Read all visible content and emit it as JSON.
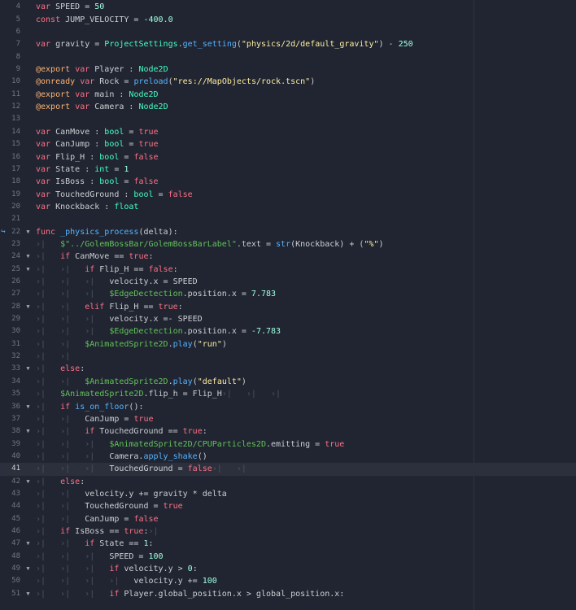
{
  "editor": {
    "current_line": 41,
    "executing_line": 22,
    "lines": [
      {
        "n": "4",
        "fold": false,
        "tokens": [
          [
            "k",
            "var"
          ],
          [
            "t",
            " SPEED = "
          ],
          [
            "n",
            "50"
          ]
        ]
      },
      {
        "n": "5",
        "fold": false,
        "tokens": [
          [
            "k",
            "const"
          ],
          [
            "t",
            " JUMP_VELOCITY = "
          ],
          [
            "n",
            "-400.0"
          ]
        ]
      },
      {
        "n": "6",
        "fold": false,
        "tokens": []
      },
      {
        "n": "7",
        "fold": false,
        "tokens": [
          [
            "k",
            "var"
          ],
          [
            "t",
            " gravity = "
          ],
          [
            "ty",
            "ProjectSettings"
          ],
          [
            "t",
            "."
          ],
          [
            "f",
            "get_setting"
          ],
          [
            "t",
            "("
          ],
          [
            "s",
            "\"physics/2d/default_gravity\""
          ],
          [
            "t",
            ") - "
          ],
          [
            "n",
            "250"
          ]
        ]
      },
      {
        "n": "8",
        "fold": false,
        "tokens": []
      },
      {
        "n": "9",
        "fold": false,
        "tokens": [
          [
            "an",
            "@export"
          ],
          [
            "t",
            " "
          ],
          [
            "k",
            "var"
          ],
          [
            "t",
            " Player : "
          ],
          [
            "ty",
            "Node2D"
          ]
        ]
      },
      {
        "n": "10",
        "fold": false,
        "tokens": [
          [
            "an",
            "@onready"
          ],
          [
            "t",
            " "
          ],
          [
            "k",
            "var"
          ],
          [
            "t",
            " Rock = "
          ],
          [
            "f",
            "preload"
          ],
          [
            "t",
            "("
          ],
          [
            "s",
            "\"res://MapObjects/rock.tscn\""
          ],
          [
            "t",
            ")"
          ]
        ]
      },
      {
        "n": "11",
        "fold": false,
        "tokens": [
          [
            "an",
            "@export"
          ],
          [
            "t",
            " "
          ],
          [
            "k",
            "var"
          ],
          [
            "t",
            " main : "
          ],
          [
            "ty",
            "Node2D"
          ]
        ]
      },
      {
        "n": "12",
        "fold": false,
        "tokens": [
          [
            "an",
            "@export"
          ],
          [
            "t",
            " "
          ],
          [
            "k",
            "var"
          ],
          [
            "t",
            " Camera : "
          ],
          [
            "ty",
            "Node2D"
          ]
        ]
      },
      {
        "n": "13",
        "fold": false,
        "tokens": []
      },
      {
        "n": "14",
        "fold": false,
        "tokens": [
          [
            "k",
            "var"
          ],
          [
            "t",
            " CanMove : "
          ],
          [
            "ty",
            "bool"
          ],
          [
            "t",
            " = "
          ],
          [
            "k",
            "true"
          ]
        ]
      },
      {
        "n": "15",
        "fold": false,
        "tokens": [
          [
            "k",
            "var"
          ],
          [
            "t",
            " CanJump : "
          ],
          [
            "ty",
            "bool"
          ],
          [
            "t",
            " = "
          ],
          [
            "k",
            "true"
          ]
        ]
      },
      {
        "n": "16",
        "fold": false,
        "tokens": [
          [
            "k",
            "var"
          ],
          [
            "t",
            " Flip_H : "
          ],
          [
            "ty",
            "bool"
          ],
          [
            "t",
            " = "
          ],
          [
            "k",
            "false"
          ]
        ]
      },
      {
        "n": "17",
        "fold": false,
        "tokens": [
          [
            "k",
            "var"
          ],
          [
            "t",
            " State : "
          ],
          [
            "ty",
            "int"
          ],
          [
            "t",
            " = "
          ],
          [
            "n",
            "1"
          ]
        ]
      },
      {
        "n": "18",
        "fold": false,
        "tokens": [
          [
            "k",
            "var"
          ],
          [
            "t",
            " IsBoss : "
          ],
          [
            "ty",
            "bool"
          ],
          [
            "t",
            " = "
          ],
          [
            "k",
            "false"
          ]
        ]
      },
      {
        "n": "19",
        "fold": false,
        "tokens": [
          [
            "k",
            "var"
          ],
          [
            "t",
            " TouchedGround : "
          ],
          [
            "ty",
            "bool"
          ],
          [
            "t",
            " = "
          ],
          [
            "k",
            "false"
          ]
        ]
      },
      {
        "n": "20",
        "fold": false,
        "tokens": [
          [
            "k",
            "var"
          ],
          [
            "t",
            " Knockback : "
          ],
          [
            "ty",
            "float"
          ]
        ]
      },
      {
        "n": "21",
        "fold": false,
        "tokens": []
      },
      {
        "n": "22",
        "fold": true,
        "tokens": [
          [
            "k",
            "func"
          ],
          [
            "t",
            " "
          ],
          [
            "f",
            "_physics_process"
          ],
          [
            "t",
            "(delta):"
          ]
        ]
      },
      {
        "n": "23",
        "fold": false,
        "tokens": [
          [
            "tab",
            "›|   "
          ],
          [
            "np",
            "$\"../GolemBossBar/GolemBossBarLabel\""
          ],
          [
            "t",
            ".text = "
          ],
          [
            "f",
            "str"
          ],
          [
            "t",
            "(Knockback) + ("
          ],
          [
            "s",
            "\"%\""
          ],
          [
            "t",
            ")"
          ]
        ]
      },
      {
        "n": "24",
        "fold": true,
        "tokens": [
          [
            "tab",
            "›|   "
          ],
          [
            "k",
            "if"
          ],
          [
            "t",
            " CanMove == "
          ],
          [
            "k",
            "true"
          ],
          [
            "t",
            ":"
          ]
        ]
      },
      {
        "n": "25",
        "fold": true,
        "tokens": [
          [
            "tab",
            "›|   ›|   "
          ],
          [
            "k",
            "if"
          ],
          [
            "t",
            " Flip_H == "
          ],
          [
            "k",
            "false"
          ],
          [
            "t",
            ":"
          ]
        ]
      },
      {
        "n": "26",
        "fold": false,
        "tokens": [
          [
            "tab",
            "›|   ›|   ›|   "
          ],
          [
            "t",
            "velocity.x = SPEED"
          ]
        ]
      },
      {
        "n": "27",
        "fold": false,
        "tokens": [
          [
            "tab",
            "›|   ›|   ›|   "
          ],
          [
            "np",
            "$EdgeDectection"
          ],
          [
            "t",
            ".position.x = "
          ],
          [
            "n",
            "7.783"
          ]
        ]
      },
      {
        "n": "28",
        "fold": true,
        "tokens": [
          [
            "tab",
            "›|   ›|   "
          ],
          [
            "k",
            "elif"
          ],
          [
            "t",
            " Flip_H == "
          ],
          [
            "k",
            "true"
          ],
          [
            "t",
            ":"
          ]
        ]
      },
      {
        "n": "29",
        "fold": false,
        "tokens": [
          [
            "tab",
            "›|   ›|   ›|   "
          ],
          [
            "t",
            "velocity.x =- SPEED"
          ]
        ]
      },
      {
        "n": "30",
        "fold": false,
        "tokens": [
          [
            "tab",
            "›|   ›|   ›|   "
          ],
          [
            "np",
            "$EdgeDectection"
          ],
          [
            "t",
            ".position.x = "
          ],
          [
            "n",
            "-7.783"
          ]
        ]
      },
      {
        "n": "31",
        "fold": false,
        "tokens": [
          [
            "tab",
            "›|   ›|   "
          ],
          [
            "np",
            "$AnimatedSprite2D"
          ],
          [
            "t",
            "."
          ],
          [
            "f",
            "play"
          ],
          [
            "t",
            "("
          ],
          [
            "s",
            "\"run\""
          ],
          [
            "t",
            ")"
          ]
        ]
      },
      {
        "n": "32",
        "fold": false,
        "tokens": [
          [
            "tab",
            "›|   ›|   "
          ]
        ]
      },
      {
        "n": "33",
        "fold": true,
        "tokens": [
          [
            "tab",
            "›|   "
          ],
          [
            "k",
            "else"
          ],
          [
            "t",
            ":"
          ]
        ]
      },
      {
        "n": "34",
        "fold": false,
        "tokens": [
          [
            "tab",
            "›|   ›|   "
          ],
          [
            "np",
            "$AnimatedSprite2D"
          ],
          [
            "t",
            "."
          ],
          [
            "f",
            "play"
          ],
          [
            "t",
            "("
          ],
          [
            "s",
            "\"default\""
          ],
          [
            "t",
            ")"
          ]
        ]
      },
      {
        "n": "35",
        "fold": false,
        "tokens": [
          [
            "tab",
            "›|   "
          ],
          [
            "np",
            "$AnimatedSprite2D"
          ],
          [
            "t",
            ".flip_h = Flip_H"
          ],
          [
            "tab",
            "›|   ›|   ›|"
          ]
        ]
      },
      {
        "n": "36",
        "fold": true,
        "tokens": [
          [
            "tab",
            "›|   "
          ],
          [
            "k",
            "if"
          ],
          [
            "t",
            " "
          ],
          [
            "f",
            "is_on_floor"
          ],
          [
            "t",
            "():"
          ]
        ]
      },
      {
        "n": "37",
        "fold": false,
        "tokens": [
          [
            "tab",
            "›|   ›|   "
          ],
          [
            "t",
            "CanJump = "
          ],
          [
            "k",
            "true"
          ]
        ]
      },
      {
        "n": "38",
        "fold": true,
        "tokens": [
          [
            "tab",
            "›|   ›|   "
          ],
          [
            "k",
            "if"
          ],
          [
            "t",
            " TouchedGround == "
          ],
          [
            "k",
            "true"
          ],
          [
            "t",
            ":"
          ]
        ]
      },
      {
        "n": "39",
        "fold": false,
        "tokens": [
          [
            "tab",
            "›|   ›|   ›|   "
          ],
          [
            "np",
            "$AnimatedSprite2D/CPUParticles2D"
          ],
          [
            "t",
            ".emitting = "
          ],
          [
            "k",
            "true"
          ]
        ]
      },
      {
        "n": "40",
        "fold": false,
        "tokens": [
          [
            "tab",
            "›|   ›|   ›|   "
          ],
          [
            "t",
            "Camera."
          ],
          [
            "f",
            "apply_shake"
          ],
          [
            "t",
            "()"
          ]
        ]
      },
      {
        "n": "41",
        "fold": false,
        "tokens": [
          [
            "tab",
            "›|   ›|   ›|   "
          ],
          [
            "t",
            "TouchedGround = "
          ],
          [
            "k",
            "false"
          ],
          [
            "tab",
            "›|   ›|"
          ]
        ]
      },
      {
        "n": "42",
        "fold": true,
        "tokens": [
          [
            "tab",
            "›|   "
          ],
          [
            "k",
            "else"
          ],
          [
            "t",
            ":"
          ]
        ]
      },
      {
        "n": "43",
        "fold": false,
        "tokens": [
          [
            "tab",
            "›|   ›|   "
          ],
          [
            "t",
            "velocity.y += gravity * delta"
          ]
        ]
      },
      {
        "n": "44",
        "fold": false,
        "tokens": [
          [
            "tab",
            "›|   ›|   "
          ],
          [
            "t",
            "TouchedGround = "
          ],
          [
            "k",
            "true"
          ]
        ]
      },
      {
        "n": "45",
        "fold": false,
        "tokens": [
          [
            "tab",
            "›|   ›|   "
          ],
          [
            "t",
            "CanJump = "
          ],
          [
            "k",
            "false"
          ]
        ]
      },
      {
        "n": "46",
        "fold": false,
        "tokens": [
          [
            "tab",
            "›|   "
          ],
          [
            "k",
            "if"
          ],
          [
            "t",
            " IsBoss == "
          ],
          [
            "k",
            "true"
          ],
          [
            "t",
            ":"
          ],
          [
            "tab",
            "›|"
          ]
        ]
      },
      {
        "n": "47",
        "fold": true,
        "tokens": [
          [
            "tab",
            "›|   ›|   "
          ],
          [
            "k",
            "if"
          ],
          [
            "t",
            " State == "
          ],
          [
            "n",
            "1"
          ],
          [
            "t",
            ":"
          ]
        ]
      },
      {
        "n": "48",
        "fold": false,
        "tokens": [
          [
            "tab",
            "›|   ›|   ›|   "
          ],
          [
            "t",
            "SPEED = "
          ],
          [
            "n",
            "100"
          ]
        ]
      },
      {
        "n": "49",
        "fold": true,
        "tokens": [
          [
            "tab",
            "›|   ›|   ›|   "
          ],
          [
            "k",
            "if"
          ],
          [
            "t",
            " velocity.y > "
          ],
          [
            "n",
            "0"
          ],
          [
            "t",
            ":"
          ]
        ]
      },
      {
        "n": "50",
        "fold": false,
        "tokens": [
          [
            "tab",
            "›|   ›|   ›|   ›|   "
          ],
          [
            "t",
            "velocity.y += "
          ],
          [
            "n",
            "100"
          ]
        ]
      },
      {
        "n": "51",
        "fold": true,
        "tokens": [
          [
            "tab",
            "›|   ›|   ›|   "
          ],
          [
            "k",
            "if"
          ],
          [
            "t",
            " Player.global_position.x > global_position.x:"
          ]
        ]
      }
    ]
  },
  "icons": {
    "fold": "chevron-down-icon",
    "executing": "executing-arrow-icon"
  },
  "colors": {
    "background": "#202531",
    "current_line": "#2b303c",
    "keyword": "#ff7085",
    "type": "#42ffc2",
    "number": "#a1ffe0",
    "string": "#ffeda1",
    "function": "#57b3ff",
    "node_path": "#63c259",
    "annotation": "#ffb373",
    "line_number": "#71767f"
  }
}
